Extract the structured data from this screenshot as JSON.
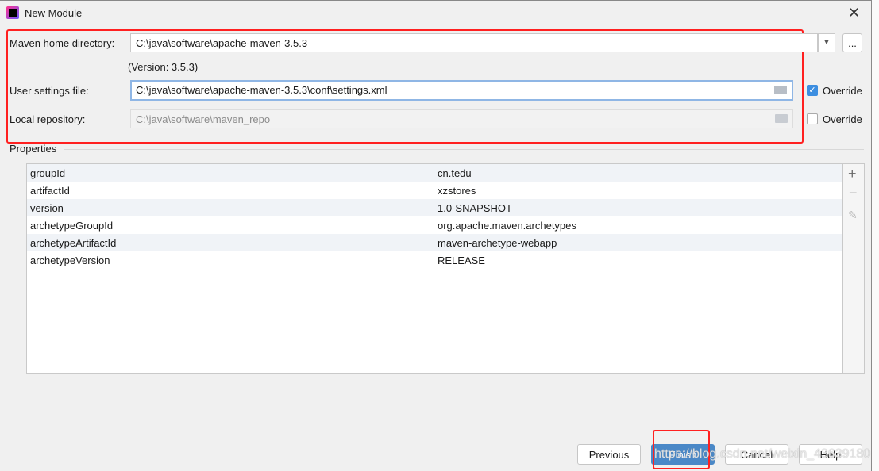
{
  "dialog": {
    "title": "New Module"
  },
  "form": {
    "maven_home_label": "Maven home directory:",
    "maven_home_value": "C:\\java\\software\\apache-maven-3.5.3",
    "version_text": "(Version: 3.5.3)",
    "user_settings_label": "User settings file:",
    "user_settings_value": "C:\\java\\software\\apache-maven-3.5.3\\conf\\settings.xml",
    "user_settings_override": true,
    "local_repo_label": "Local repository:",
    "local_repo_value": "C:\\java\\software\\maven_repo",
    "local_repo_override": false,
    "override_label": "Override",
    "browse_label": "..."
  },
  "properties": {
    "title": "Properties",
    "rows": [
      {
        "key": "groupId",
        "value": "cn.tedu"
      },
      {
        "key": "artifactId",
        "value": "xzstores"
      },
      {
        "key": "version",
        "value": "1.0-SNAPSHOT"
      },
      {
        "key": "archetypeGroupId",
        "value": "org.apache.maven.archetypes"
      },
      {
        "key": "archetypeArtifactId",
        "value": "maven-archetype-webapp"
      },
      {
        "key": "archetypeVersion",
        "value": "RELEASE"
      }
    ]
  },
  "buttons": {
    "previous": "Previous",
    "finish": "Finish",
    "cancel": "Cancel",
    "help": "Help"
  },
  "watermark": "https://blog.csdn.net/weixin_43639180"
}
